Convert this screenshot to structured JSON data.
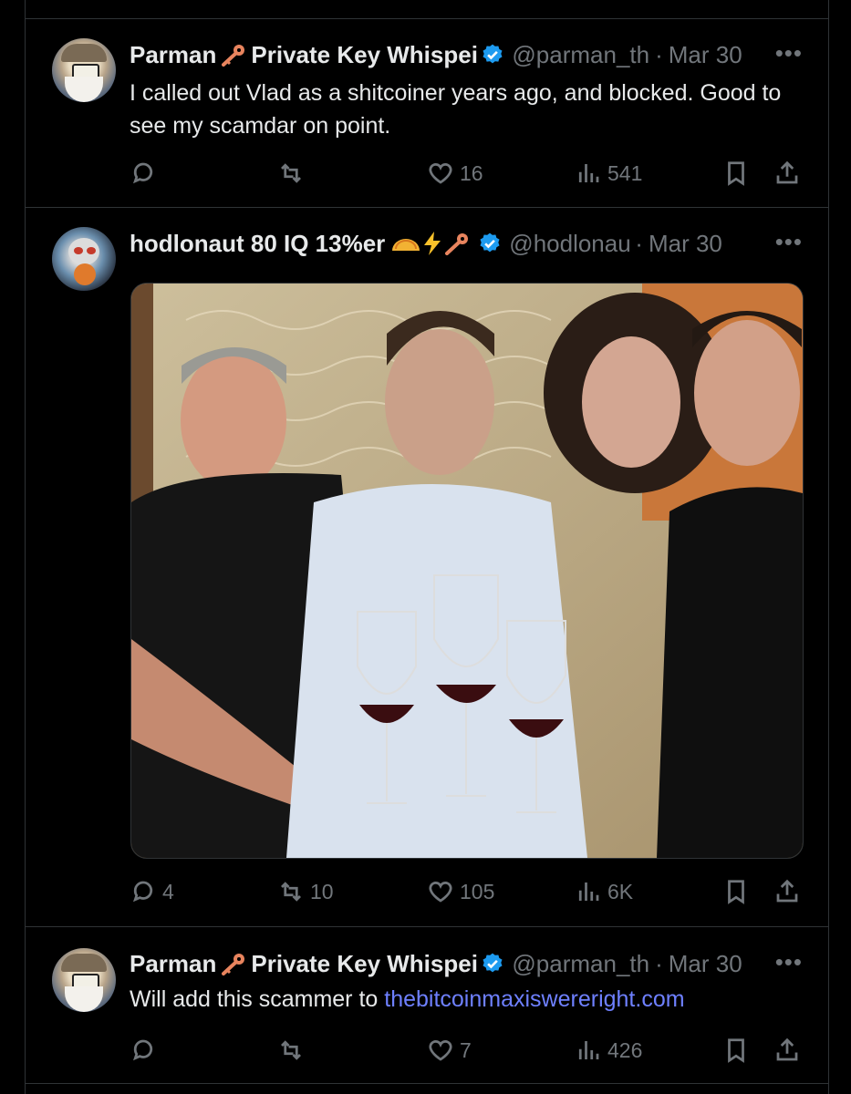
{
  "tweets": [
    {
      "author": {
        "name": "Parman",
        "display_suffix": "Private Key Whispei",
        "handle": "@parman_th",
        "date": "Mar 30",
        "verified": true
      },
      "text": "I called out Vlad as a shitcoiner years ago, and blocked. Good to see my scamdar on point.",
      "actions": {
        "replies": "",
        "reposts": "",
        "likes": "16",
        "views": "541"
      }
    },
    {
      "author": {
        "name": "hodlonaut 80 IQ 13%er",
        "display_suffix": "",
        "handle": "@hodlonau",
        "date": "Mar 30",
        "verified": true
      },
      "text": "",
      "actions": {
        "replies": "4",
        "reposts": "10",
        "likes": "105",
        "views": "6K"
      },
      "media": {
        "kind": "photo"
      }
    },
    {
      "author": {
        "name": "Parman",
        "display_suffix": "Private Key Whispei",
        "handle": "@parman_th",
        "date": "Mar 30",
        "verified": true
      },
      "text_prefix": "Will add this scammer to ",
      "link": "thebitcoinmaxiswereright.com",
      "actions": {
        "replies": "",
        "reposts": "",
        "likes": "7",
        "views": "426"
      }
    }
  ],
  "more_label": "•••",
  "dot": "·",
  "colors": {
    "background": "#000000",
    "text": "#e7e9ea",
    "muted": "#71767b",
    "link": "#6e80ff",
    "verified": "#1d9bf0",
    "border": "#2f3336"
  },
  "icons": [
    "reply-icon",
    "repost-icon",
    "like-icon",
    "views-icon",
    "bookmark-icon",
    "share-icon",
    "verified-badge-icon",
    "key-icon",
    "taco-emoji",
    "lightning-emoji"
  ]
}
